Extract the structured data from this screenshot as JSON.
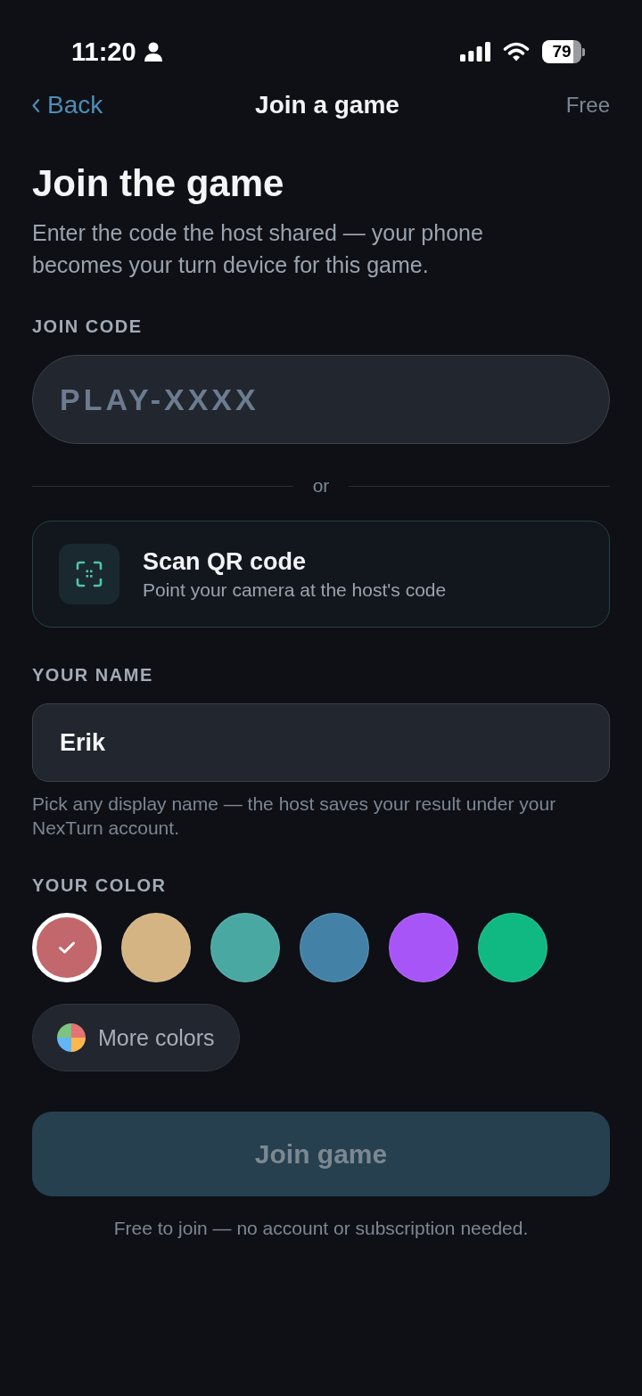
{
  "status_bar": {
    "time": "11:20",
    "battery": "79"
  },
  "nav": {
    "back": "Back",
    "title": "Join a game",
    "plan": "Free"
  },
  "header": {
    "title": "Join the game",
    "subtitle": "Enter the code the host shared — your phone becomes your turn device for this game."
  },
  "join_code": {
    "label": "JOIN CODE",
    "placeholder": "PLAY-XXXX"
  },
  "divider": {
    "label": "or"
  },
  "scan_card": {
    "title": "Scan QR code",
    "subtitle": "Point your camera at the host's code"
  },
  "name": {
    "label": "YOUR NAME",
    "value": "Erik",
    "hint": "Pick any display name — the host saves your result under your NexTurn account."
  },
  "color": {
    "label": "YOUR COLOR",
    "swatches": [
      {
        "color": "#c2676b",
        "selected": true
      },
      {
        "color": "#d4b483",
        "selected": false
      },
      {
        "color": "#4aa8a3",
        "selected": false
      },
      {
        "color": "#4381a6",
        "selected": false
      },
      {
        "color": "#a855f7",
        "selected": false
      },
      {
        "color": "#10b981",
        "selected": false
      }
    ],
    "more_button": "More colors"
  },
  "join_button": {
    "label": "Join game",
    "disabled": true
  },
  "footer": "Free to join — no account or subscription needed."
}
